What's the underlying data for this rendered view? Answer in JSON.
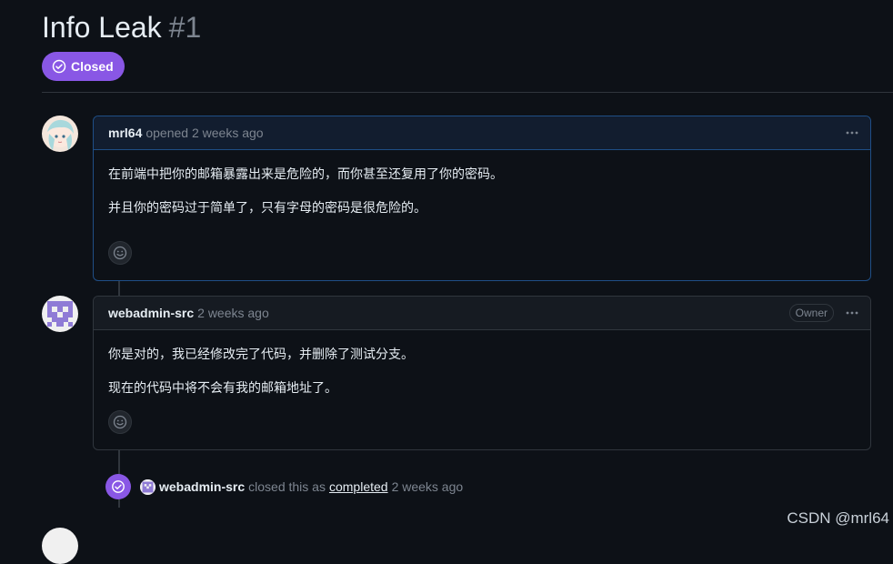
{
  "issue": {
    "title": "Info Leak",
    "number": "#1",
    "state": "Closed",
    "state_color": "#8957e5"
  },
  "comments": [
    {
      "user": "mrl64",
      "meta": "opened 2 weeks ago",
      "paragraphs": [
        "在前端中把你的邮箱暴露出来是危险的，而你甚至还复用了你的密码。",
        "并且你的密码过于简单了，只有字母的密码是很危险的。"
      ],
      "avatar_icon": "anime-avatar"
    },
    {
      "user": "webadmin-src",
      "meta": "2 weeks ago",
      "badge": "Owner",
      "paragraphs": [
        "你是对的，我已经修改完了代码，并删除了测试分支。",
        "现在的代码中将不会有我的邮箱地址了。"
      ],
      "avatar_icon": "identicon-avatar"
    }
  ],
  "event": {
    "user": "webadmin-src",
    "text_before": "closed this as",
    "link": "completed",
    "time": "2 weeks ago",
    "icon": "check-circle-icon"
  },
  "watermark": "CSDN @mrl64",
  "colors": {
    "background": "#0d1117",
    "border": "#30363d",
    "muted": "#7d8590",
    "closed_purple": "#8957e5",
    "author_border": "#1f4e86"
  }
}
